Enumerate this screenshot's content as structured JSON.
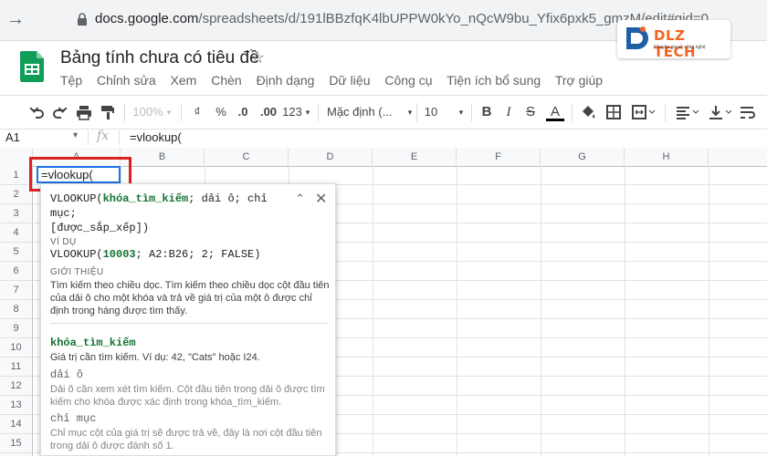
{
  "browser": {
    "url_host": "docs.google.com",
    "url_path": "/spreadsheets/d/191lBBzfqK4lbUPPW0kYo_nQcW9bu_Yfix6pxk5_gmzM/edit#gid=0"
  },
  "watermark": {
    "name": "DLZ TECH",
    "tagline": "Chuyên gia về công nghệ"
  },
  "doc": {
    "title": "Bảng tính chưa có tiêu đề",
    "menus": [
      "Tệp",
      "Chỉnh sửa",
      "Xem",
      "Chèn",
      "Định dạng",
      "Dữ liệu",
      "Công cụ",
      "Tiện ích bổ sung",
      "Trợ giúp"
    ]
  },
  "toolbar": {
    "zoom": "100%",
    "currency": "₫",
    "percent": "%",
    "dec_less": ".0",
    "dec_more": ".00",
    "number_format": "123",
    "font": "Mặc định (...",
    "font_size": "10",
    "bold": "B",
    "italic": "I",
    "strike": "S",
    "text_color": "A"
  },
  "formula_bar": {
    "cell_ref": "A1",
    "fx": "fx",
    "content": "=vlookup("
  },
  "grid": {
    "columns": [
      "A",
      "B",
      "C",
      "D",
      "E",
      "F",
      "G",
      "H"
    ],
    "rows": [
      "1",
      "2",
      "3",
      "4",
      "5",
      "6",
      "7",
      "8",
      "9",
      "10",
      "11",
      "12",
      "13",
      "14",
      "15",
      "16",
      "17"
    ],
    "a1_value": "=vlookup("
  },
  "help": {
    "fn": "VLOOKUP(",
    "arg1": "khóa_tìm_kiếm",
    "sig_rest": "; dải ô; chỉ mục;",
    "sig_line2": "[được_sắp_xếp])",
    "example_label": "VÍ DỤ",
    "example_fn": "VLOOKUP(",
    "example_num": "10003",
    "example_rest": "; A2:B26; 2; FALSE)",
    "intro_label": "GIỚI THIỆU",
    "intro": "Tìm kiếm theo chiều dọc. Tìm kiếm theo chiều dọc cột đầu tiên của dải ô cho một khóa và trả về giá trị của một ô được chỉ định trong hàng được tìm thấy.",
    "args": [
      {
        "name": "khóa_tìm_kiếm",
        "desc": "Giá trị cần tìm kiếm. Ví dụ: 42, \"Cats\" hoặc I24."
      },
      {
        "name": "dải ô",
        "desc": "Dải ô cần xem xét tìm kiếm. Cột đầu tiên trong dải ô được tìm kiếm cho khóa được xác định trong khóa_tìm_kiếm."
      },
      {
        "name": "chỉ mục",
        "desc": "Chỉ mục cột của giá trị sẽ được trả về, đây là nơi cột đầu tiên trong dải ô được đánh số 1."
      }
    ]
  },
  "colors": {
    "accent": "#1a73e8",
    "highlight": "#e02020",
    "arg": "#137333",
    "brand": "#f26522"
  }
}
